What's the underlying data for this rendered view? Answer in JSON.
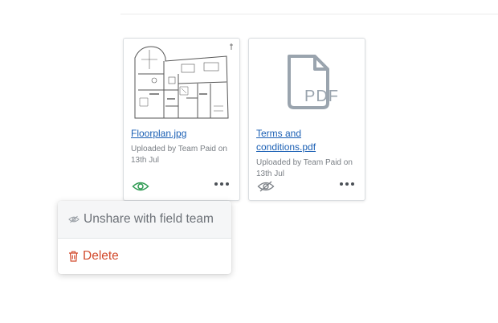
{
  "files": [
    {
      "name": "Floorplan.jpg",
      "meta": "Uploaded by Team Paid on 13th Jul",
      "preview_icon": "floorplan-thumbnail",
      "shared": true,
      "share_icon": "eye-icon",
      "share_color": "#2e9a52"
    },
    {
      "name": "Terms and conditions.pdf",
      "meta": "Uploaded by Team Paid on 13th Jul",
      "preview_icon": "pdf-file-icon",
      "preview_text": "PDF",
      "shared": false,
      "share_icon": "eye-slash-icon"
    }
  ],
  "menu": {
    "unshare_label": "Unshare with field team",
    "unshare_icon": "eye-slash-icon",
    "delete_label": "Delete",
    "delete_icon": "trash-icon",
    "delete_color": "#d24a2c"
  }
}
